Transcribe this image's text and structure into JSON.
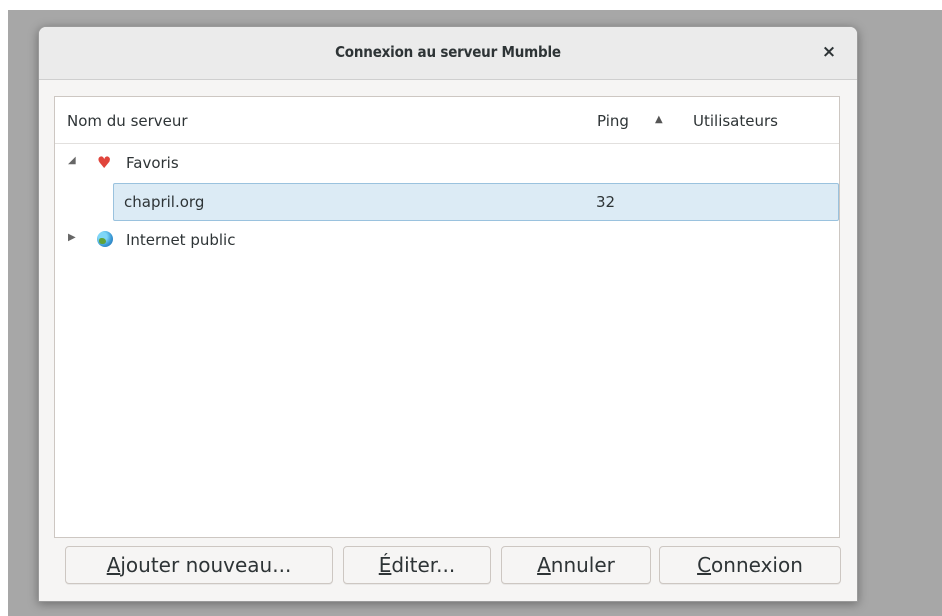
{
  "window": {
    "title": "Connexion au serveur Mumble",
    "close": "×"
  },
  "columns": {
    "name": "Nom du serveur",
    "ping": "Ping",
    "users": "Utilisateurs",
    "sort_indicator": "▲"
  },
  "tree": {
    "favorites": {
      "label": "Favoris",
      "expanded": true,
      "expander": "◢",
      "icon": "heart-icon",
      "heart_glyph": "♥"
    },
    "favorite_server": {
      "name": "chapril.org",
      "ping": "32",
      "users": "",
      "selected": true
    },
    "public": {
      "label": "Internet public",
      "expanded": false,
      "expander": "▶",
      "icon": "globe-icon"
    }
  },
  "buttons": {
    "add": {
      "accel": "A",
      "rest": "jouter nouveau..."
    },
    "edit": {
      "accel": "É",
      "rest": "diter..."
    },
    "cancel": {
      "accel": "A",
      "rest": "nnuler"
    },
    "connect": {
      "accel": "C",
      "rest": "onnexion"
    }
  },
  "colors": {
    "selection_bg": "#dcebf5",
    "selection_border": "#9ac2de",
    "heart": "#e0443b"
  }
}
